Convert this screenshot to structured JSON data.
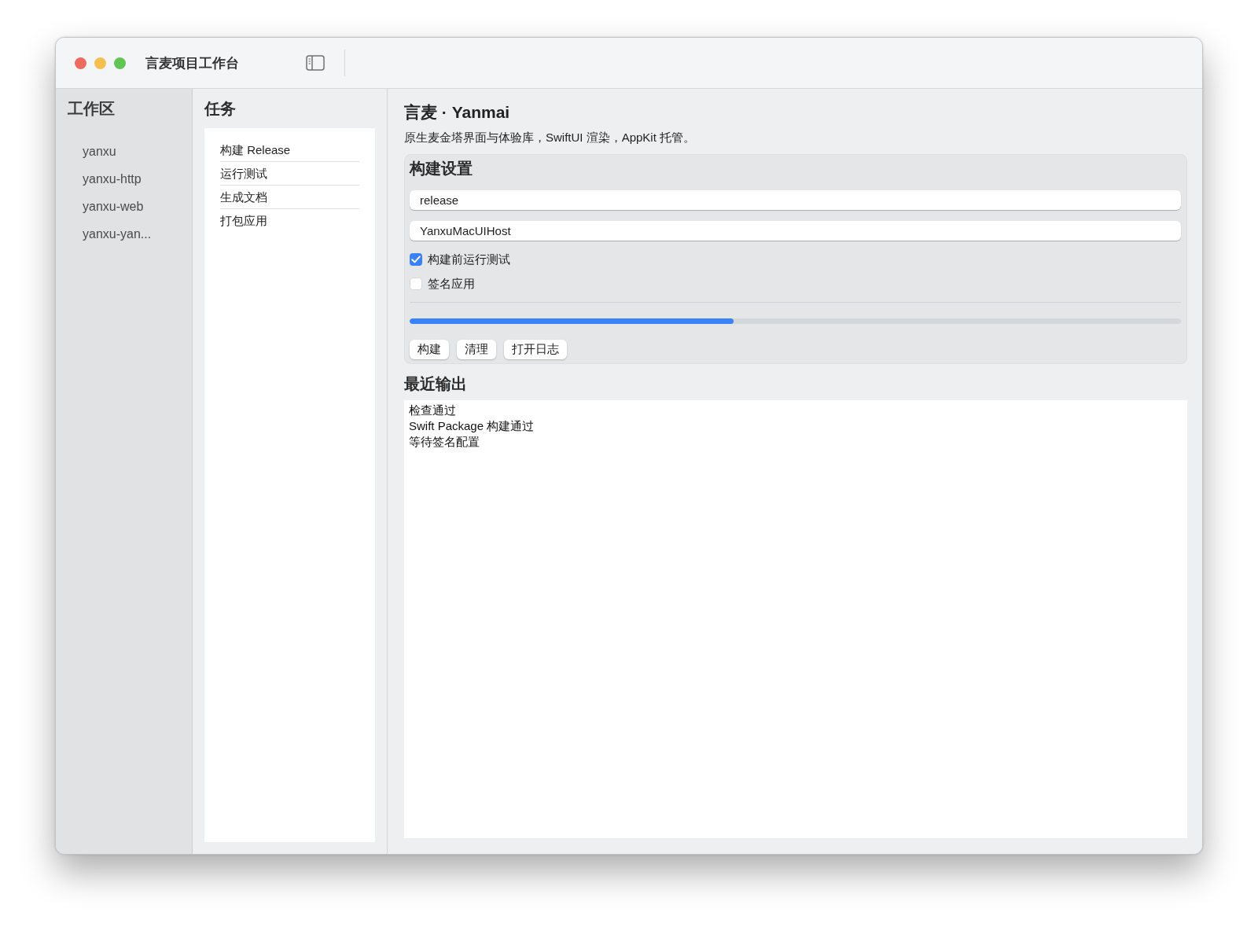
{
  "window": {
    "title": "言麦项目工作台"
  },
  "sidebar": {
    "heading": "工作区",
    "items": [
      {
        "label": "yanxu"
      },
      {
        "label": "yanxu-http"
      },
      {
        "label": "yanxu-web"
      },
      {
        "label": "yanxu-yan..."
      }
    ]
  },
  "tasks": {
    "heading": "任务",
    "items": [
      {
        "label": "构建 Release"
      },
      {
        "label": "运行测试"
      },
      {
        "label": "生成文档"
      },
      {
        "label": "打包应用"
      }
    ]
  },
  "detail": {
    "title": "言麦 · Yanmai",
    "subtitle": "原生麦金塔界面与体验库，SwiftUI 渲染，AppKit 托管。"
  },
  "build_settings": {
    "heading": "构建设置",
    "fields": [
      {
        "value": "release"
      },
      {
        "value": "YanxuMacUIHost"
      }
    ],
    "options": [
      {
        "label": "构建前运行测试",
        "checked": true
      },
      {
        "label": "签名应用",
        "checked": false
      }
    ],
    "progress": {
      "level": 0.42
    },
    "buttons": [
      {
        "label": "构建"
      },
      {
        "label": "清理"
      },
      {
        "label": "打开日志"
      }
    ]
  },
  "output": {
    "heading": "最近输出",
    "lines": [
      "检查通过",
      "Swift Package 构建通过",
      "等待签名配置"
    ]
  }
}
